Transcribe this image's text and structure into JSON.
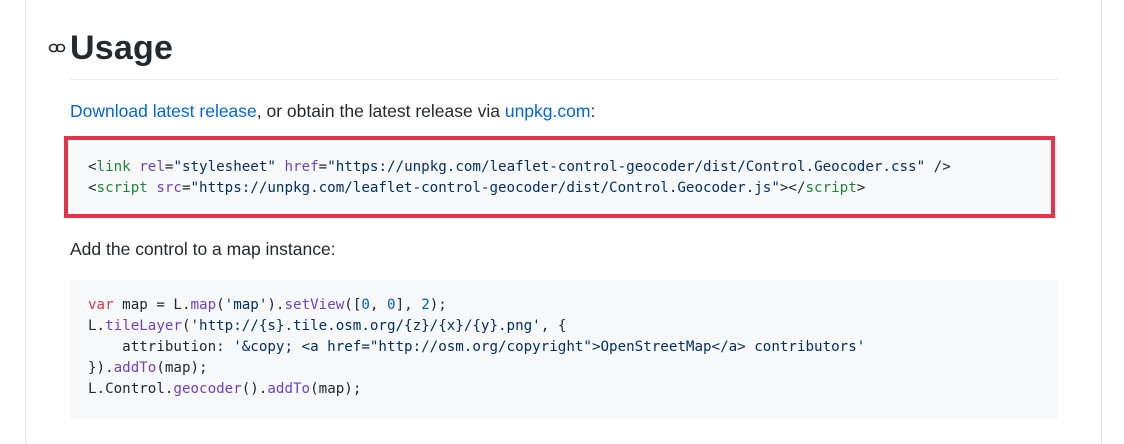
{
  "section": {
    "title": "Usage"
  },
  "intro": {
    "link1": "Download latest release",
    "middle": ", or obtain the latest release via ",
    "link2": "unpkg.com",
    "end": ":"
  },
  "code1": {
    "line1": {
      "lt": "<",
      "tag": "link",
      "sp1": " ",
      "attr1": "rel",
      "eq1": "=",
      "val1": "\"stylesheet\"",
      "sp2": " ",
      "attr2": "href",
      "eq2": "=",
      "val2": "\"https://unpkg.com/leaflet-control-geocoder/dist/Control.Geocoder.css\"",
      "end": " />"
    },
    "line2": {
      "lt": "<",
      "tag": "script",
      "sp1": " ",
      "attr1": "src",
      "eq1": "=",
      "val1": "\"https://unpkg.com/leaflet-control-geocoder/dist/Control.Geocoder.js\"",
      "gt": "></",
      "tag2": "script",
      "end": ">"
    }
  },
  "para2": "Add the control to a map instance:",
  "code2": {
    "l1": {
      "kw": "var",
      "a": " map = L.",
      "fn1": "map",
      "b": "(",
      "s1": "'map'",
      "c": ").",
      "fn2": "setView",
      "d": "([",
      "n1": "0",
      "e": ", ",
      "n2": "0",
      "f": "], ",
      "n3": "2",
      "g": ");"
    },
    "l2": {
      "a": "L.",
      "fn1": "tileLayer",
      "b": "(",
      "s1": "'http://{s}.tile.osm.org/{z}/{x}/{y}.png'",
      "c": ", {"
    },
    "l3": {
      "a": "    attribution: ",
      "s1": "'&copy; <a href=\"http://osm.org/copyright\">OpenStreetMap</a> contributors'"
    },
    "l4": {
      "a": "}).",
      "fn1": "addTo",
      "b": "(map);"
    },
    "l5": {
      "a": "L.Control.",
      "fn1": "geocoder",
      "b": "().",
      "fn2": "addTo",
      "c": "(map);"
    }
  },
  "colors": {
    "link": "#0366d6",
    "highlight_border": "#e8324a",
    "code_bg": "#f6f8fa"
  },
  "icons": {
    "anchor": "link-icon"
  }
}
